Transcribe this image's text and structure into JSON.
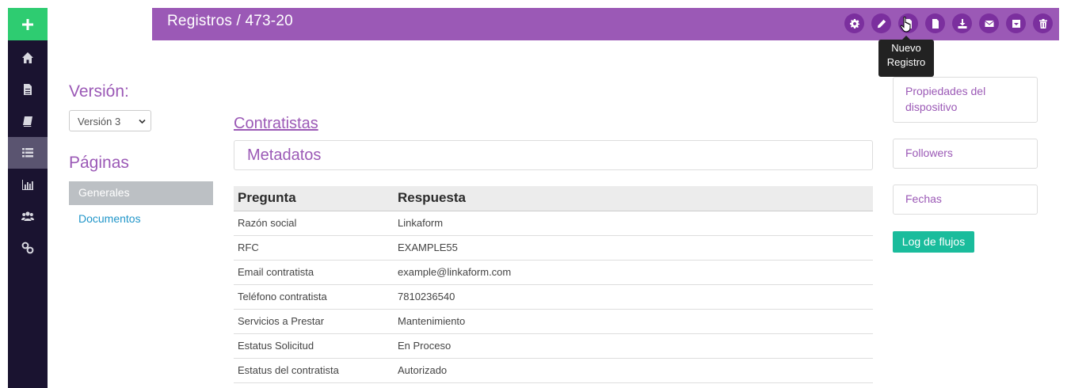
{
  "header": {
    "title": "Registros / 473-20"
  },
  "toolbar": {
    "icons": [
      "gear-icon",
      "pencil-icon",
      "new-record-icon",
      "file-icon",
      "download-icon",
      "envelope-icon",
      "archive-icon",
      "trash-icon"
    ],
    "tooltip_line1": "Nuevo",
    "tooltip_line2": "Registro"
  },
  "sidebar": {
    "icons": [
      "home-icon",
      "document-icon",
      "book-icon",
      "list-icon",
      "bar-chart-icon",
      "users-icon",
      "link-icon"
    ],
    "active": "list-icon"
  },
  "version": {
    "label": "Versión:",
    "selected": "Versión 3"
  },
  "pages": {
    "label": "Páginas",
    "items": [
      {
        "label": "Generales",
        "active": true
      },
      {
        "label": "Documentos",
        "active": false
      }
    ]
  },
  "main": {
    "form_name": "Contratistas",
    "section_title": "Metadatos",
    "table": {
      "headers": [
        "Pregunta",
        "Respuesta"
      ],
      "rows": [
        [
          "Razón social",
          "Linkaform"
        ],
        [
          "RFC",
          "EXAMPLE55"
        ],
        [
          "Email contratista",
          "example@linkaform.com"
        ],
        [
          "Teléfono contratista",
          "7810236540"
        ],
        [
          "Servicios a Prestar",
          "Mantenimiento"
        ],
        [
          "Estatus Solicitud",
          "En Proceso"
        ],
        [
          "Estatus del contratista",
          "Autorizado"
        ]
      ]
    }
  },
  "right_panel": {
    "boxes": [
      "Propiedades del dispositivo",
      "Followers",
      "Fechas"
    ],
    "log_button": "Log de flujos"
  },
  "colors": {
    "brand_purple": "#9b59b6",
    "toolbar_button": "#7b2f9e",
    "add_green": "#2ecc71",
    "teal_button": "#1abc9c",
    "rail_bg": "#1a1330",
    "link_blue": "#2196c9"
  }
}
